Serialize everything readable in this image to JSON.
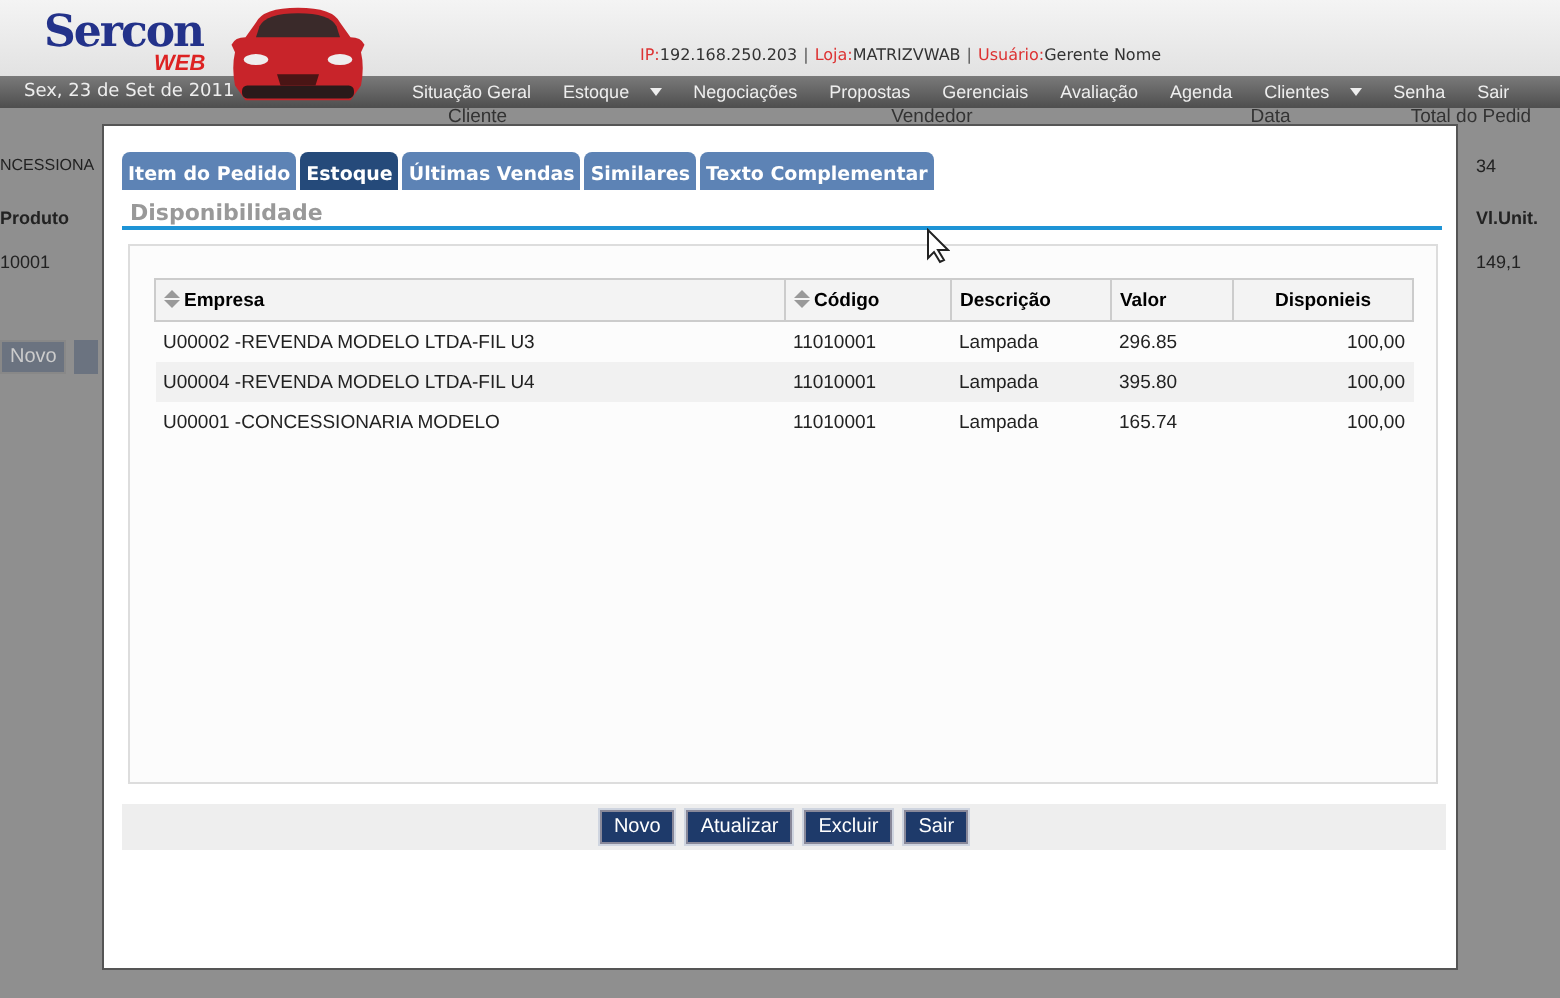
{
  "header": {
    "logo": {
      "name": "Sercon",
      "sub": "WEB"
    },
    "info": [
      {
        "label": "IP:",
        "value": "192.168.250.203"
      },
      {
        "separator": "|",
        "label": "Loja:",
        "value": "MATRIZVWAB"
      },
      {
        "separator": "|",
        "label": "Usuário:",
        "value": "Gerente Nome"
      }
    ]
  },
  "nav": {
    "date": "Sex, 23 de Set de 2011",
    "items": [
      {
        "label": "Situação Geral",
        "dropdown": false
      },
      {
        "label": "Estoque",
        "dropdown": true
      },
      {
        "label": "Negociações",
        "dropdown": false
      },
      {
        "label": "Propostas",
        "dropdown": false
      },
      {
        "label": "Gerenciais",
        "dropdown": false
      },
      {
        "label": "Avaliação",
        "dropdown": false
      },
      {
        "label": "Agenda",
        "dropdown": false
      },
      {
        "label": "Clientes",
        "dropdown": true
      },
      {
        "label": "Senha",
        "dropdown": false
      },
      {
        "label": "Sair",
        "dropdown": false
      }
    ]
  },
  "background_page": {
    "labels": [
      "Cliente",
      "Vendedor",
      "Data",
      "Total do Pedid"
    ],
    "cliente_value": "NCESSIONA",
    "total_value": "34",
    "columns": [
      "Produto",
      "Vl.Unit."
    ],
    "row": [
      "10001",
      "149,1"
    ],
    "button": "Novo"
  },
  "dialog": {
    "tabs": [
      {
        "label": "Item do Pedido",
        "selected": false
      },
      {
        "label": "Estoque",
        "selected": true
      },
      {
        "label": "Últimas Vendas",
        "selected": false
      },
      {
        "label": "Similares",
        "selected": false
      },
      {
        "label": "Texto Complementar",
        "selected": false
      }
    ],
    "section_title": "Disponibilidade",
    "table": {
      "columns": [
        {
          "label": "Empresa",
          "sortable": true
        },
        {
          "label": "Código",
          "sortable": true
        },
        {
          "label": "Descrição",
          "sortable": false
        },
        {
          "label": "Valor",
          "sortable": false
        },
        {
          "label": "Disponieis",
          "sortable": false
        }
      ],
      "rows": [
        [
          "U00002 -REVENDA MODELO LTDA-FIL U3",
          "11010001",
          "Lampada",
          "296.85",
          "100,00"
        ],
        [
          "U00004 -REVENDA MODELO LTDA-FIL U4",
          "11010001",
          "Lampada",
          "395.80",
          "100,00"
        ],
        [
          "U00001 -CONCESSIONARIA MODELO",
          "11010001",
          "Lampada",
          "165.74",
          "100,00"
        ]
      ]
    },
    "buttons": [
      "Novo",
      "Atualizar",
      "Excluir",
      "Sair"
    ]
  }
}
